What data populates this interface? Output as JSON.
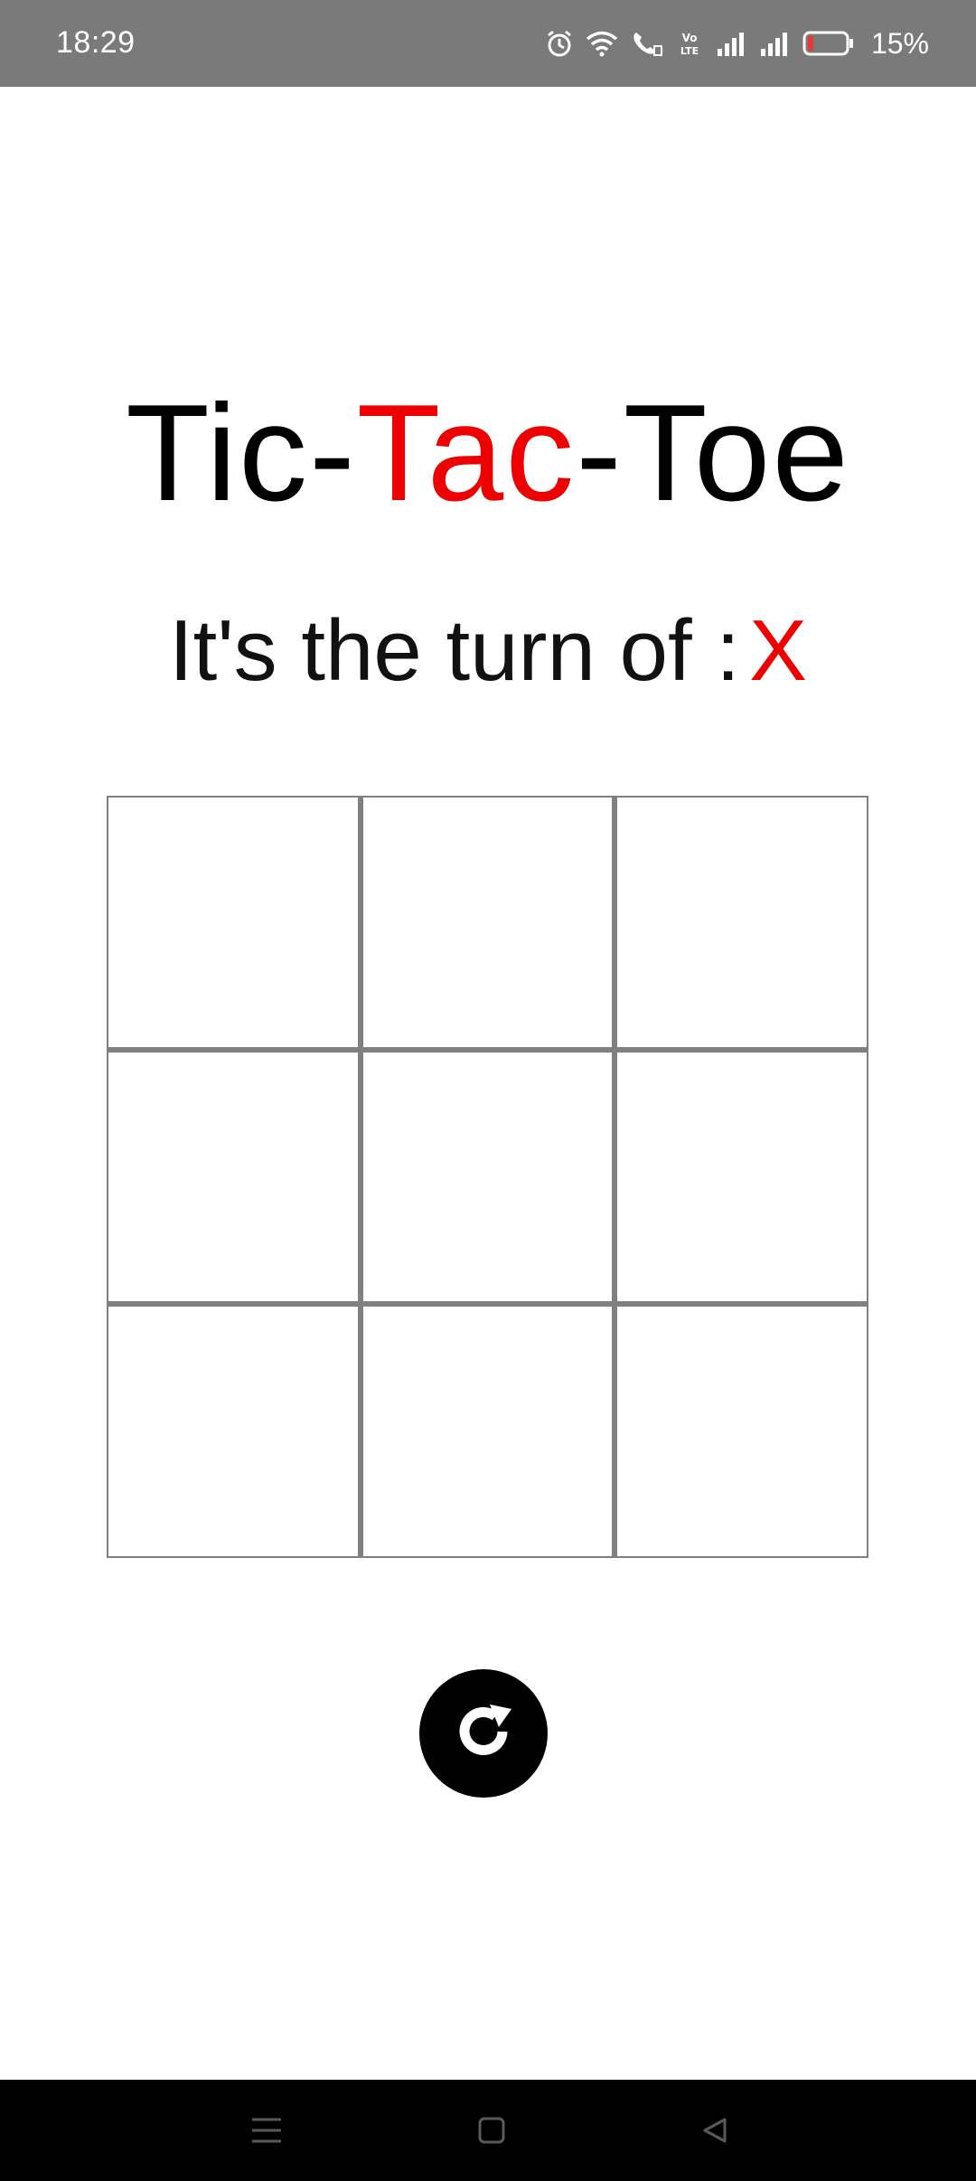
{
  "status_bar": {
    "time": "18:29",
    "battery_percent": "15%",
    "battery_level": 0.15,
    "icons": [
      "alarm-icon",
      "wifi-icon",
      "wifi-calling-icon",
      "volte-icon",
      "signal-1-icon",
      "signal-2-icon",
      "battery-icon"
    ]
  },
  "game": {
    "title_part1": "Tic-",
    "title_accent": "Tac",
    "title_part2": "-Toe",
    "turn_label": "It's the turn of :",
    "current_player": "X",
    "board": [
      "",
      "",
      "",
      "",
      "",
      "",
      "",
      "",
      ""
    ],
    "accent_color": "#ee0000",
    "grid_color": "#808080",
    "reset_icon": "refresh-icon"
  },
  "nav_bar": {
    "items": [
      "menu-icon",
      "home-icon",
      "back-icon"
    ]
  }
}
